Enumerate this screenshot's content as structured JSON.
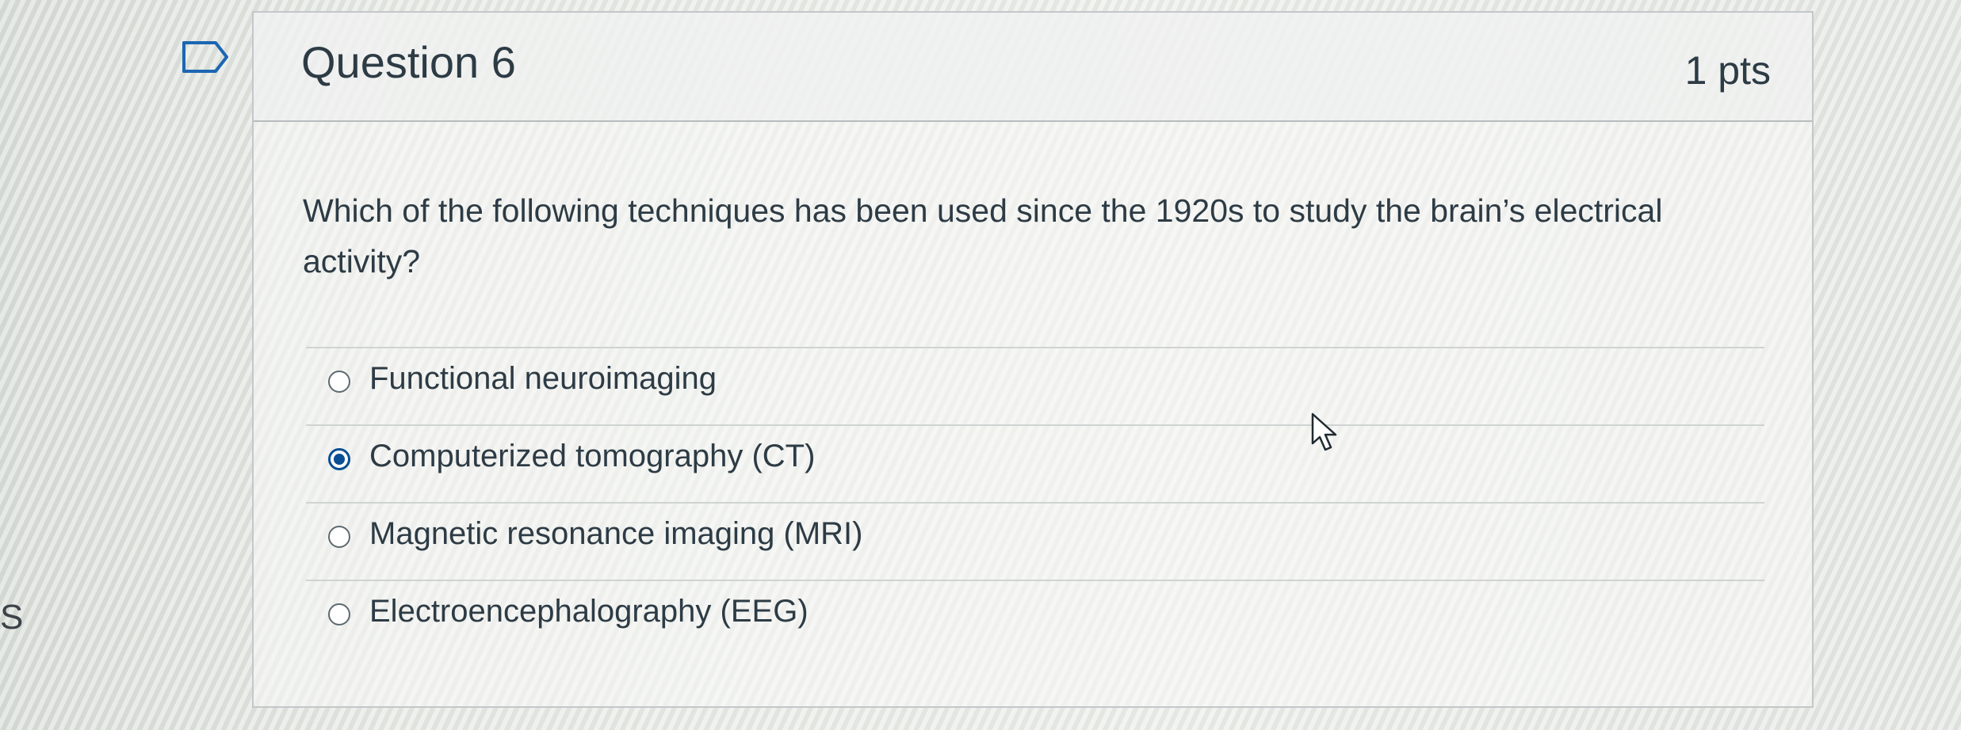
{
  "edge_text": "S",
  "question": {
    "title": "Question 6",
    "points": "1 pts",
    "text": "Which of the following techniques has been used since the 1920s to study the brain’s electrical activity?",
    "answers": [
      {
        "label": "Functional neuroimaging",
        "selected": false
      },
      {
        "label": "Computerized tomography (CT)",
        "selected": true
      },
      {
        "label": "Magnetic resonance imaging (MRI)",
        "selected": false
      },
      {
        "label": "Electroencephalography (EEG)",
        "selected": false
      }
    ]
  },
  "icons": {
    "flag": "flag-icon",
    "cursor": "mouse-pointer-icon"
  },
  "colors": {
    "selected_radio": "#0a4e94",
    "text": "#2d3b45",
    "border": "#c3c7c9"
  }
}
